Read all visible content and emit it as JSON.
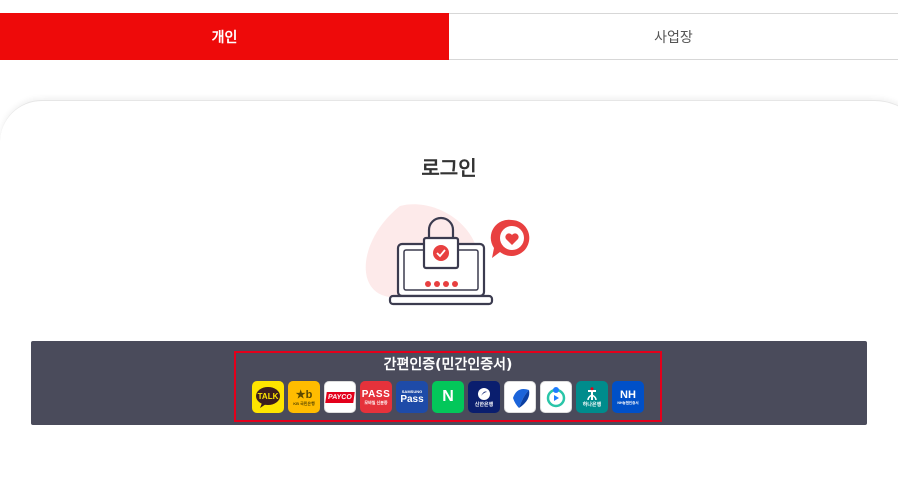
{
  "tabs": [
    {
      "label": "개인",
      "active": true
    },
    {
      "label": "사업장",
      "active": false
    }
  ],
  "login": {
    "title": "로그인"
  },
  "cert": {
    "title": "간편인증(민간인증서)",
    "providers": [
      {
        "name": "kakao-talk",
        "label": "TALK",
        "color": "#fee500"
      },
      {
        "name": "kb",
        "label": "KB 국민은행",
        "color": "#ffbc00"
      },
      {
        "name": "payco",
        "label": "PAYCO",
        "color": "#ffffff"
      },
      {
        "name": "pass",
        "label": "PASS",
        "sublabel": "모바일 신분증",
        "color": "#e5323b"
      },
      {
        "name": "samsung-pass",
        "label": "Pass",
        "sublabel": "SAMSUNG",
        "color": "#1e4ba8"
      },
      {
        "name": "naver",
        "label": "N",
        "color": "#03c75a"
      },
      {
        "name": "shinhan",
        "label": "신한은행",
        "color": "#0a1e6e"
      },
      {
        "name": "toss",
        "label": "",
        "color": "#ffffff"
      },
      {
        "name": "banksalad",
        "label": "",
        "color": "#ffffff"
      },
      {
        "name": "hana",
        "label": "하나은행",
        "color": "#008c8c"
      },
      {
        "name": "nh",
        "label": "NH",
        "sublabel": "NH농협인증서",
        "color": "#0050c8"
      }
    ]
  }
}
